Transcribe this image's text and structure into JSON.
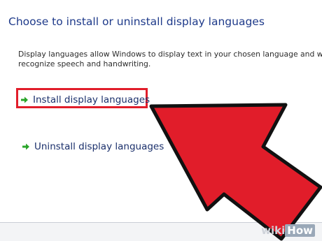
{
  "page": {
    "title": "Choose to install or uninstall display languages",
    "description_line1": "Display languages allow Windows to display text in your chosen language and where suppo",
    "description_line2": "recognize speech and handwriting."
  },
  "options": [
    {
      "label": "Install display languages",
      "icon": "green-arrow-icon",
      "highlighted": true
    },
    {
      "label": "Uninstall display languages",
      "icon": "green-arrow-icon",
      "highlighted": false
    }
  ],
  "overlay": {
    "pointer_color": "#e11d2a",
    "watermark_part1": "wiki",
    "watermark_part2": "How"
  },
  "colors": {
    "title": "#1e3a8a",
    "link": "#1a2f6b",
    "arrow": "#2aa52a",
    "highlight": "#e11d2a"
  }
}
